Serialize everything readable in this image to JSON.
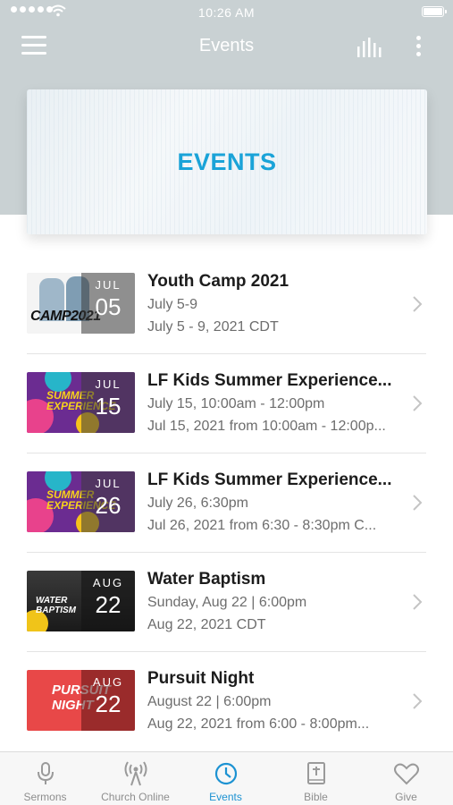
{
  "status_bar": {
    "time": "10:26 AM"
  },
  "nav": {
    "title": "Events"
  },
  "banner": {
    "title": "EVENTS"
  },
  "events": [
    {
      "title": "Youth Camp 2021",
      "line1": "July 5-9",
      "line2": "July 5 - 9, 2021 CDT",
      "month": "JUL",
      "day": "05",
      "thumb_text": "CAMP2021"
    },
    {
      "title": "LF Kids Summer Experience...",
      "line1": "July 15, 10:00am - 12:00pm",
      "line2": "Jul 15, 2021 from 10:00am - 12:00p...",
      "month": "JUL",
      "day": "15",
      "thumb_text": "SUMMER EXPERIENCE"
    },
    {
      "title": "LF Kids Summer Experience...",
      "line1": "July 26, 6:30pm",
      "line2": "Jul 26, 2021 from 6:30 - 8:30pm C...",
      "month": "JUL",
      "day": "26",
      "thumb_text": "SUMMER EXPERIENCE"
    },
    {
      "title": "Water Baptism",
      "line1": "Sunday, Aug 22 | 6:00pm",
      "line2": "Aug 22, 2021 CDT",
      "month": "AUG",
      "day": "22",
      "thumb_text": "WATER BAPTISM"
    },
    {
      "title": "Pursuit Night",
      "line1": "August 22 | 6:00pm",
      "line2": "Aug 22, 2021 from 6:00 - 8:00pm...",
      "month": "AUG",
      "day": "22",
      "thumb_text": "PURSUIT NIGHT"
    }
  ],
  "tabs": [
    {
      "label": "Sermons",
      "icon": "microphone-icon",
      "active": false
    },
    {
      "label": "Church Online",
      "icon": "broadcast-icon",
      "active": false
    },
    {
      "label": "Events",
      "icon": "clock-icon",
      "active": true
    },
    {
      "label": "Bible",
      "icon": "bible-icon",
      "active": false
    },
    {
      "label": "Give",
      "icon": "heart-icon",
      "active": false
    }
  ],
  "colors": {
    "accent": "#1c92d2",
    "banner_text": "#1aa3d8",
    "header_bg": "#c9d1d3"
  }
}
